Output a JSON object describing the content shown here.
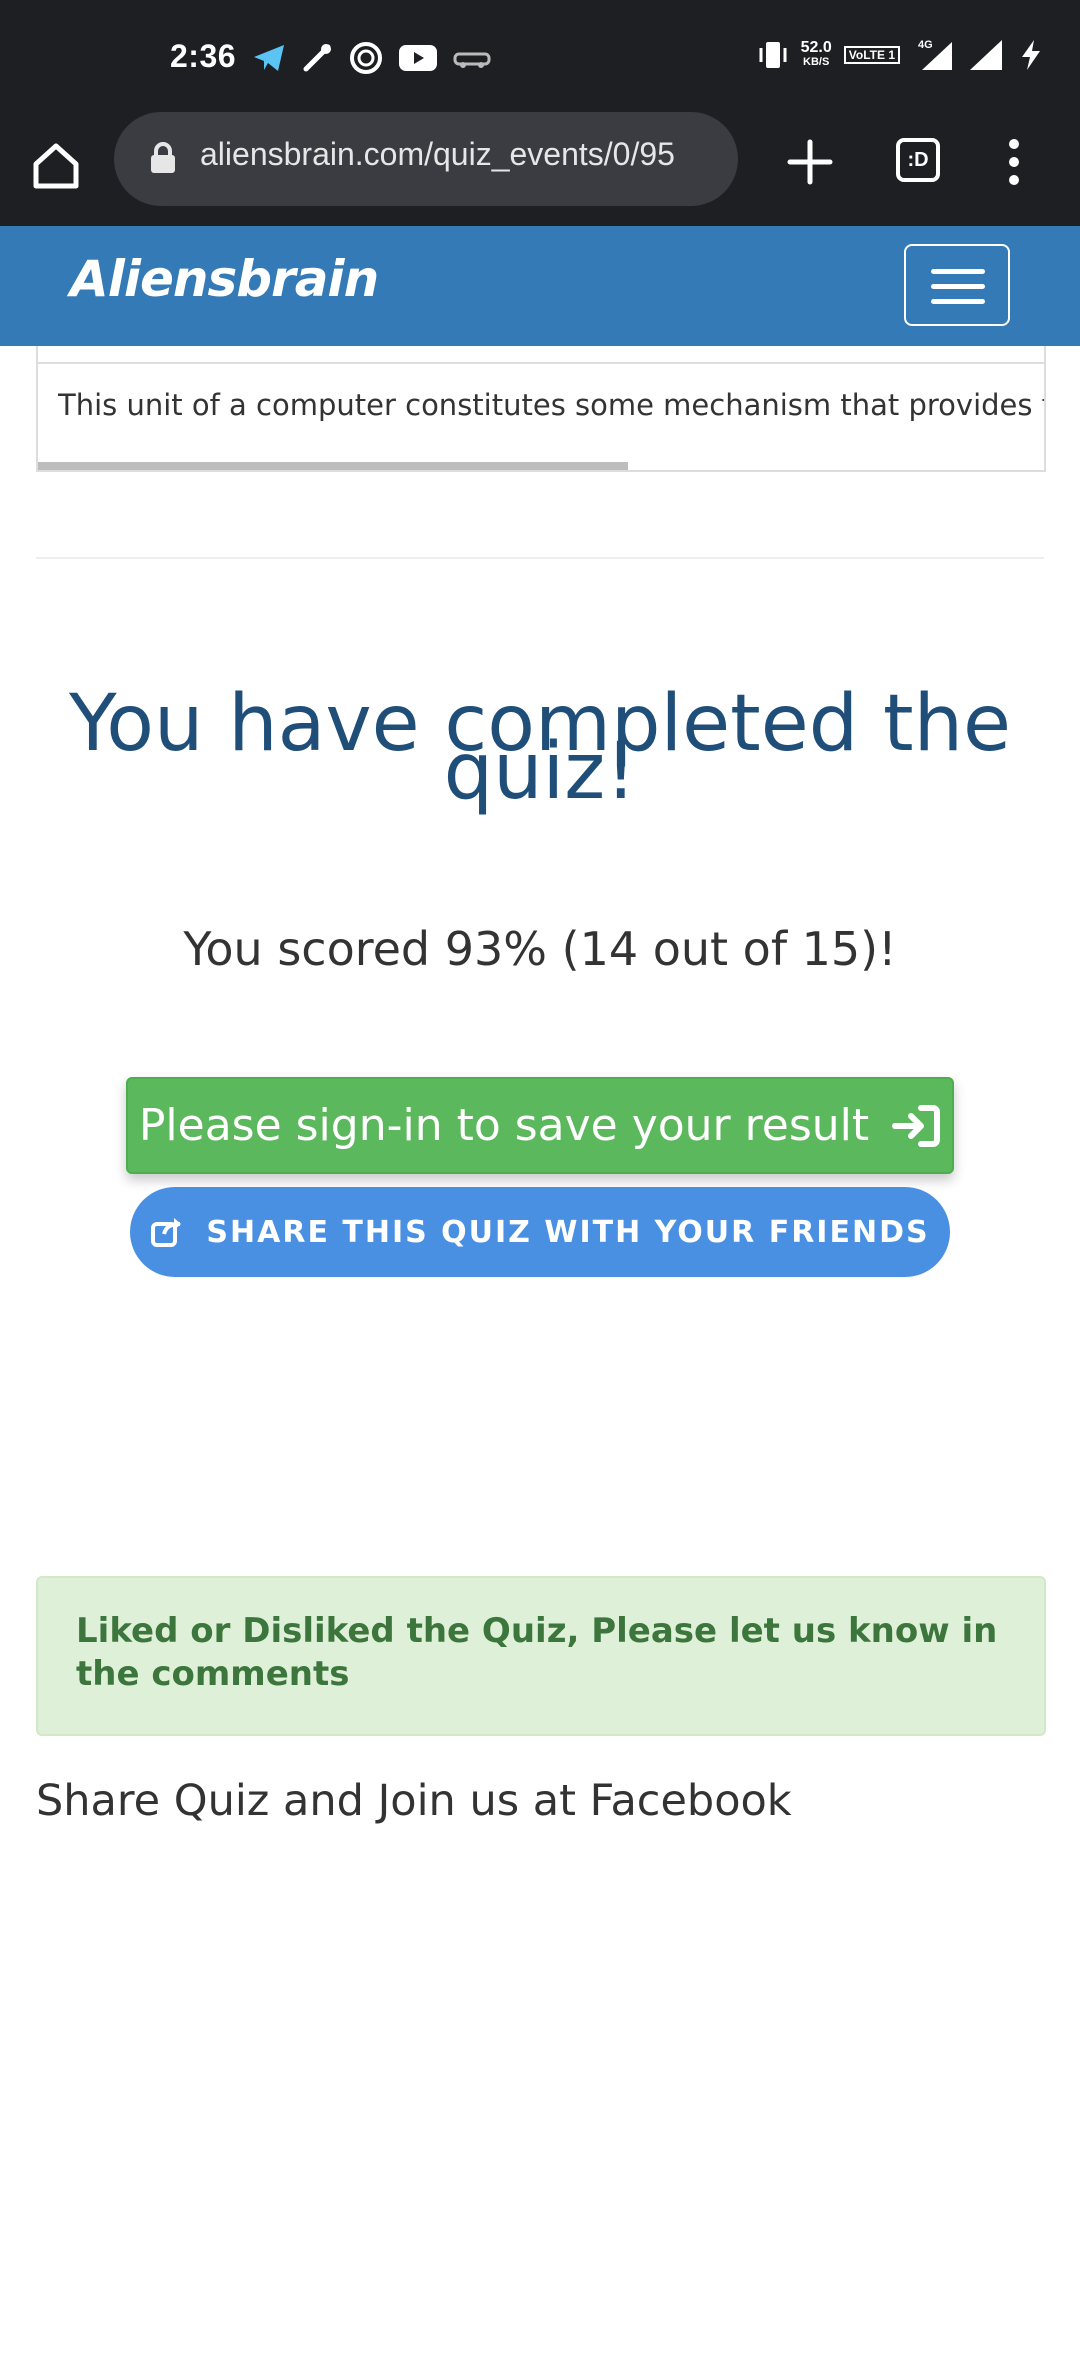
{
  "status_bar": {
    "time": "2:36",
    "speed_value": "52.0",
    "speed_unit": "KB/S",
    "volte_label": "VoLTE 1",
    "network_label": "4G",
    "left_icons": [
      "telegram-icon",
      "satellite-icon",
      "swirl-icon",
      "youtube-icon",
      "car-icon"
    ],
    "right_icons": [
      "vibrate-icon",
      "signal-icon",
      "signal-icon",
      "charging-icon"
    ]
  },
  "browser": {
    "url": "aliensbrain.com/quiz_events/0/95",
    "tabs_label": ":D"
  },
  "site": {
    "brand": "Aliensbrain"
  },
  "table": {
    "cell_text": "This unit of a computer constitutes some mechanism that provides fo"
  },
  "result": {
    "title_line1": "You have completed the",
    "title_line2": "quiz!",
    "score": "You scored 93% (14 out of 15)!"
  },
  "buttons": {
    "signin_label": "Please sign-in to save your result",
    "share_label": "SHARE THIS QUIZ WITH YOUR FRIENDS"
  },
  "feedback": {
    "alert_text": "Liked or Disliked the Quiz, Please let us know in the comments",
    "facebook_text": "Share Quiz and Join us at Facebook"
  },
  "colors": {
    "status_bg": "#1d1f23",
    "nav_bg": "#337ab7",
    "title_color": "#1f4e79",
    "signin_bg": "#5cb85c",
    "share_bg": "#4a90e2",
    "alert_bg": "#dff0d8",
    "alert_text": "#3c763d"
  }
}
